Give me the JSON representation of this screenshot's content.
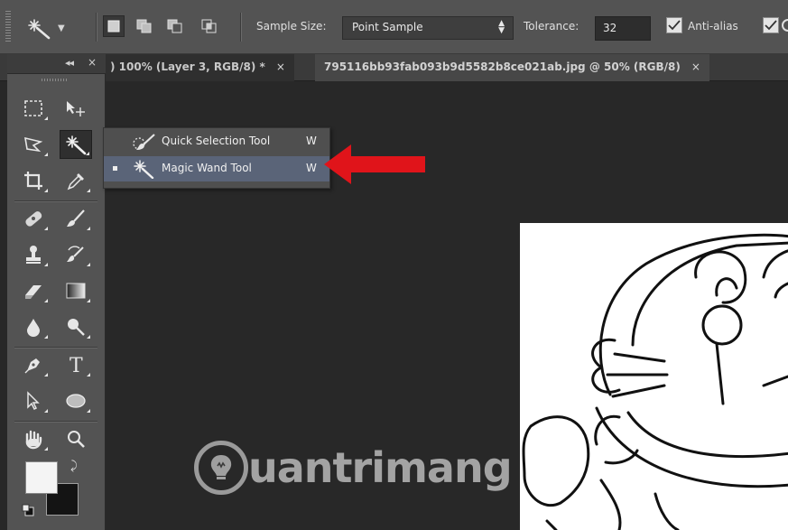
{
  "options_bar": {
    "sample_size_label": "Sample Size:",
    "sample_size_value": "Point Sample",
    "tolerance_label": "Tolerance:",
    "tolerance_value": "32",
    "anti_alias_label": "Anti-alias",
    "anti_alias_checked": true,
    "contiguous_checked": true
  },
  "tabs": [
    {
      "label": ") 100% (Layer 3, RGB/8) *",
      "close": "×"
    },
    {
      "label": "795116bb93fab093b9d5582b8ce021ab.jpg @ 50% (RGB/8)",
      "close": "×"
    }
  ],
  "toolbox": {
    "collapse_label": "◂◂",
    "close_label": "×"
  },
  "flyout": {
    "items": [
      {
        "label": "Quick Selection Tool",
        "shortcut": "W",
        "selected": false,
        "icon": "quick-selection-icon"
      },
      {
        "label": "Magic Wand Tool",
        "shortcut": "W",
        "selected": true,
        "icon": "magic-wand-icon"
      }
    ]
  },
  "watermark": {
    "text": "uantrimang",
    "icon": "lightbulb-icon"
  },
  "colors": {
    "accent_highlight": "#5a6478",
    "arrow": "#e0141a",
    "foreground_swatch": "#f4f4f4",
    "background_swatch": "#141414"
  }
}
